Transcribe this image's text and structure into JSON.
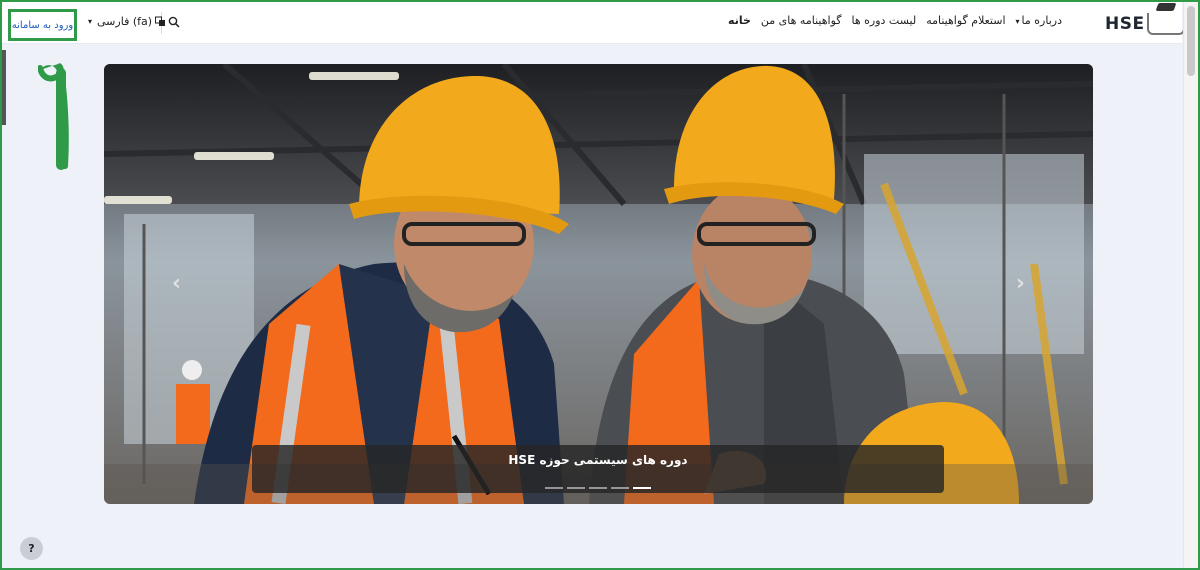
{
  "brand": {
    "logo_text": "HSE"
  },
  "nav": {
    "items": [
      {
        "label": "خانه",
        "active": true,
        "dropdown": false
      },
      {
        "label": "گواهینامه های من",
        "active": false,
        "dropdown": false
      },
      {
        "label": "لیست دوره ها",
        "active": false,
        "dropdown": false
      },
      {
        "label": "استعلام گواهینامه",
        "active": false,
        "dropdown": false
      },
      {
        "label": "درباره ما",
        "active": false,
        "dropdown": true
      }
    ]
  },
  "header": {
    "language_label": "فارسی (fa)",
    "login_label": "ورود به سامانه",
    "search_icon": "search-icon",
    "language_icon": "language-icon"
  },
  "annotation": {
    "number": "۱"
  },
  "carousel": {
    "caption": "دوره های سیستمی حوزه HSE",
    "slide_count": 5,
    "active_index": 4
  },
  "help": {
    "label": "?"
  },
  "colors": {
    "highlight": "#2f9a48",
    "link": "#1d5bb8",
    "helmet": "#f2a91c",
    "vest": "#f36a1d"
  }
}
